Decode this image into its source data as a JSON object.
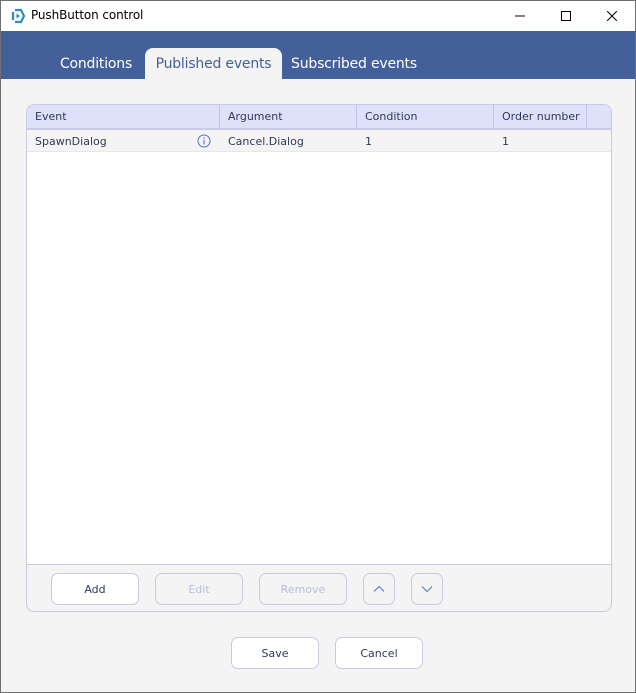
{
  "window": {
    "title": "PushButton control",
    "controls": {
      "minimize": "minimize-icon",
      "maximize": "maximize-icon",
      "close": "close-icon"
    }
  },
  "tabs": [
    {
      "label": "Conditions",
      "active": false
    },
    {
      "label": "Published events",
      "active": true
    },
    {
      "label": "Subscribed events",
      "active": false
    }
  ],
  "grid": {
    "columns": [
      "Event",
      "Argument",
      "Condition",
      "Order number"
    ],
    "rows": [
      {
        "event": "SpawnDialog",
        "info_icon": "info-icon",
        "argument": "Cancel.Dialog",
        "condition": "1",
        "order_number": "1"
      }
    ]
  },
  "grid_buttons": {
    "add": "Add",
    "edit": "Edit",
    "remove": "Remove",
    "move_up": "chevron-up-icon",
    "move_down": "chevron-down-icon"
  },
  "footer": {
    "save": "Save",
    "cancel": "Cancel"
  },
  "colors": {
    "accent": "#44609a",
    "header_bg": "#dfe1fb",
    "border": "#c9c9e4",
    "icon_blue": "#5b6fd0"
  }
}
